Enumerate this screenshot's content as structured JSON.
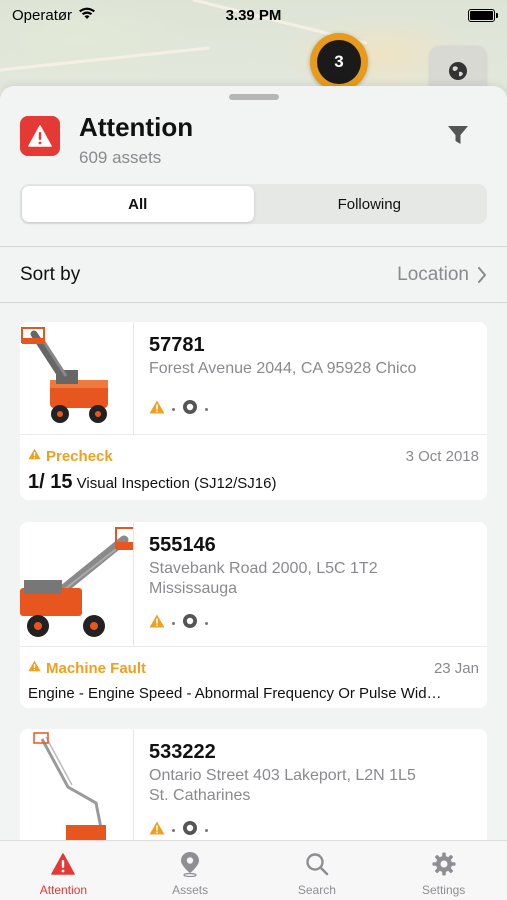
{
  "status_bar": {
    "carrier": "Operatør",
    "time": "3.39 PM"
  },
  "map": {
    "cluster_count": "3"
  },
  "header": {
    "title": "Attention",
    "subtitle": "609 assets"
  },
  "segments": [
    {
      "label": "All",
      "selected": true
    },
    {
      "label": "Following",
      "selected": false
    }
  ],
  "sort": {
    "label": "Sort by",
    "value": "Location"
  },
  "assets": [
    {
      "id": "57781",
      "address_line1": "Forest Avenue 2044, CA 95928 Chico",
      "address_line2": "",
      "alert_type": "Precheck",
      "alert_date": "3 Oct 2018",
      "progress": "1/ 15",
      "alert_description": "Visual Inspection (SJ12/SJ16)"
    },
    {
      "id": "555146",
      "address_line1": "Stavebank Road 2000, L5C 1T2",
      "address_line2": "Mississauga",
      "alert_type": "Machine Fault",
      "alert_date": "23 Jan",
      "progress": "",
      "alert_description": "Engine - Engine Speed - Abnormal Frequency Or Pulse Wid…"
    },
    {
      "id": "533222",
      "address_line1": "Ontario Street 403 Lakeport, L2N 1L5",
      "address_line2": "St. Catharines",
      "alert_type": "",
      "alert_date": "",
      "progress": "",
      "alert_description": ""
    }
  ],
  "tabs": [
    {
      "label": "Attention",
      "icon": "warning-icon",
      "active": true
    },
    {
      "label": "Assets",
      "icon": "location-pin-icon",
      "active": false
    },
    {
      "label": "Search",
      "icon": "search-icon",
      "active": false
    },
    {
      "label": "Settings",
      "icon": "gear-icon",
      "active": false
    }
  ],
  "colors": {
    "accent_red": "#e53935",
    "warning_orange": "#f0a020",
    "secondary_gray": "#8a8a8e",
    "cluster_orange": "#e79b1d"
  }
}
